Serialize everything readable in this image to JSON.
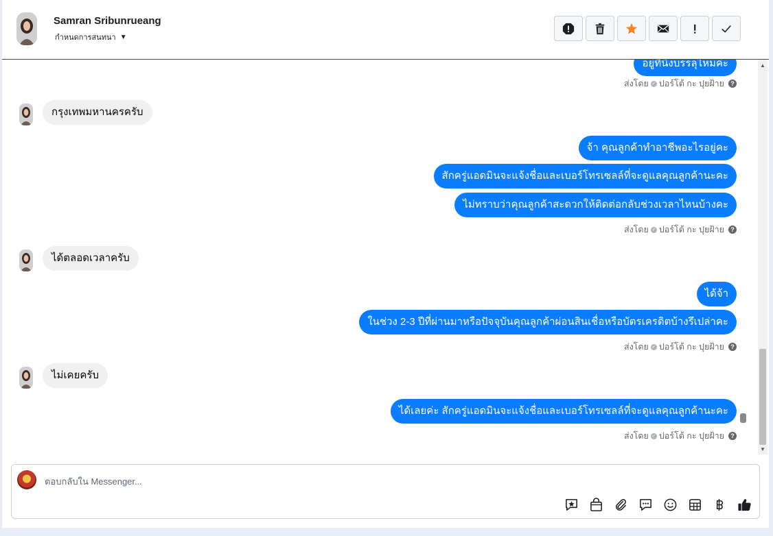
{
  "header": {
    "name": "Samran Sribunrueang",
    "subtitle": "กำหนดการสนทนา",
    "actions": [
      "spam-icon",
      "trash-icon",
      "star-icon",
      "envelope-icon",
      "exclamation-icon",
      "check-icon"
    ]
  },
  "thread": {
    "partial_top_message": "อยู่ที่นิ่งบรรลุไหมค่ะ",
    "sent_by": {
      "prefix": "ส่งโดย",
      "sender": "ปอร์โต้ กะ ปุยฝ้าย",
      "help": "?"
    },
    "messages": [
      {
        "dir": "in",
        "text": "กรุงเทพมหานครครับ"
      },
      {
        "dir": "out",
        "text": "จ้า คุณลูกค้าทำอาชีพอะไรอยู่คะ"
      },
      {
        "dir": "out",
        "text": "สักครู่แอดมินจะแจ้งชื่อและเบอร์โทรเซลล์ที่จะดูแลคุณลูกค้านะคะ"
      },
      {
        "dir": "out",
        "text": "ไม่ทราบว่าคุณลูกค้าสะดวกให้ติดต่อกลับช่วงเวลาไหนบ้างคะ"
      },
      {
        "dir": "in",
        "text": "ได้ตลอดเวลาครับ"
      },
      {
        "dir": "out",
        "text": "ได้จ้า"
      },
      {
        "dir": "out",
        "text": "ในช่วง 2-3 ปีที่ผ่านมาหรือปัจจุบันคุณลูกค้าผ่อนสินเชื่อหรือบัตรเครดิตบ้างรึเปล่าคะ"
      },
      {
        "dir": "in",
        "text": "ไม่เคยครับ"
      },
      {
        "dir": "out",
        "text": "ได้เลยค่ะ สักครู่แอดมินจะแจ้งชื่อและเบอร์โทรเซลล์ที่จะดูแลคุณลูกค้านะคะ"
      }
    ]
  },
  "composer": {
    "placeholder": "ตอบกลับใน Messenger...",
    "tools": [
      "sticker-icon",
      "shopping-bag-icon",
      "paperclip-icon",
      "saved-reply-icon",
      "emoji-icon",
      "table-icon",
      "baht-icon",
      "thumbs-up-icon"
    ]
  },
  "colors": {
    "outgoing_bubble": "#0a7cff",
    "incoming_bubble": "#f0f0f0",
    "star": "#f5822a"
  }
}
